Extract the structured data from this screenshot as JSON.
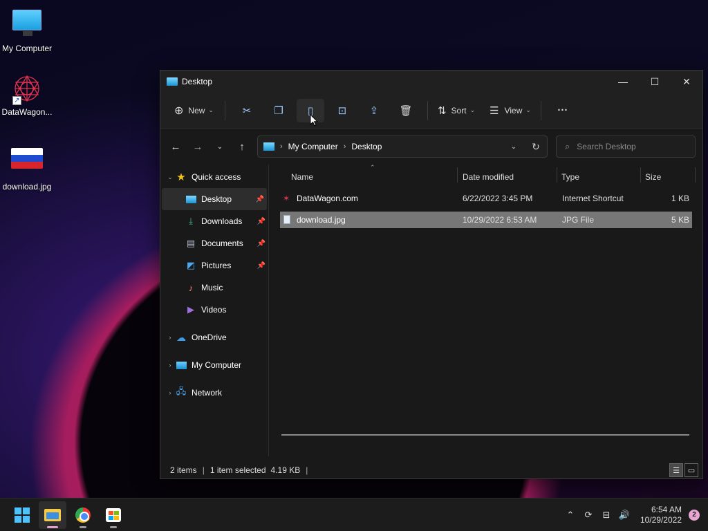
{
  "desktop": {
    "icons": [
      {
        "label": "My Computer",
        "icon": "monitor-icon"
      },
      {
        "label": "DataWagon...",
        "icon": "datawagon-shortcut-icon"
      },
      {
        "label": "download.jpg",
        "icon": "russian-flag-image-icon"
      }
    ]
  },
  "window": {
    "title": "Desktop",
    "controls": {
      "minimize": "—",
      "maximize": "☐",
      "close": "✕"
    }
  },
  "toolbar": {
    "new_label": "New",
    "sort_label": "Sort",
    "view_label": "View",
    "more_label": "···"
  },
  "address": {
    "crumbs": [
      "My Computer",
      "Desktop"
    ],
    "search_placeholder": "Search Desktop"
  },
  "navpane": {
    "quick_access": "Quick access",
    "pinned": [
      {
        "label": "Desktop",
        "icon": "desktop-folder-icon",
        "pinned": true
      },
      {
        "label": "Downloads",
        "icon": "downloads-icon",
        "pinned": true
      },
      {
        "label": "Documents",
        "icon": "documents-icon",
        "pinned": true
      },
      {
        "label": "Pictures",
        "icon": "pictures-icon",
        "pinned": true
      },
      {
        "label": "Music",
        "icon": "music-icon",
        "pinned": false
      },
      {
        "label": "Videos",
        "icon": "videos-icon",
        "pinned": false
      }
    ],
    "roots": [
      "OneDrive",
      "My Computer",
      "Network"
    ]
  },
  "columns": {
    "name": "Name",
    "date": "Date modified",
    "type": "Type",
    "size": "Size"
  },
  "files": [
    {
      "name": "DataWagon.com",
      "date": "6/22/2022 3:45 PM",
      "type": "Internet Shortcut",
      "size": "1 KB",
      "selected": false
    },
    {
      "name": "download.jpg",
      "date": "10/29/2022 6:53 AM",
      "type": "JPG File",
      "size": "5 KB",
      "selected": true
    }
  ],
  "status": {
    "items": "2 items",
    "selected": "1 item selected",
    "size": "4.19 KB"
  },
  "taskbar": {
    "time": "6:54 AM",
    "date": "10/29/2022",
    "notifications": "2"
  },
  "colors": {
    "accent": "#4cc2ff",
    "selection": "#777777",
    "window_bg": "#191919"
  }
}
